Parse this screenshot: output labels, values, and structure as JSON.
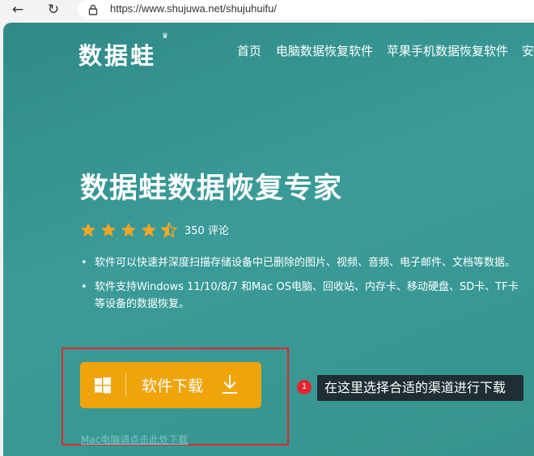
{
  "browser": {
    "back_glyph": "←",
    "reload_glyph": "↻",
    "url": "https://www.shujuwa.net/shujuhuifu/"
  },
  "header": {
    "logo": "数据蛙",
    "menu": [
      "首页",
      "电脑数据恢复软件",
      "苹果手机数据恢复软件",
      "安"
    ]
  },
  "hero": {
    "title": "数据蛙数据恢复专家",
    "rating": 4.5,
    "reviews": "350 评论",
    "bullets": [
      "软件可以快速并深度扫描存储设备中已删除的图片、视频、音频、电子邮件、文档等数据。",
      "软件支持Windows 11/10/8/7 和Mac OS电脑、回收站、内存卡、移动硬盘、SD卡、TF卡",
      "等设备的数据恢复。"
    ],
    "bullet_glyph": "•",
    "download_label": "软件下载",
    "mac_link": "Mac电脑请点击此处下载"
  },
  "annotation": {
    "badge": "1",
    "text": "在这里选择合适的渠道进行下载"
  },
  "colors": {
    "teal": "#37948f",
    "button": "#f0a40c",
    "star": "#f5a623",
    "highlight": "#e2262f",
    "callout": "#1e2e34"
  }
}
